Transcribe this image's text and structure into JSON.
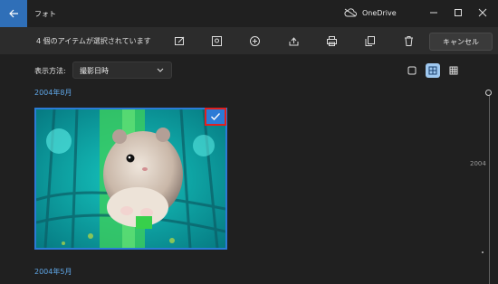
{
  "window": {
    "title": "フォト",
    "onedrive_label": "OneDrive"
  },
  "toolbar": {
    "selection_count": "4 個のアイテムが選択されています",
    "cancel_label": "キャンセル",
    "icons": [
      "edit-icon",
      "share-to-image-icon",
      "add-icon",
      "share-icon",
      "print-icon",
      "copy-icon",
      "delete-icon"
    ]
  },
  "filter": {
    "label": "表示方法:",
    "value": "撮影日時"
  },
  "view_modes": [
    "small-grid",
    "medium-grid",
    "large-grid"
  ],
  "groups": [
    {
      "date": "2004年8月",
      "photo_selected": true
    },
    {
      "date": "2004年5月"
    }
  ],
  "timeline": {
    "year": "2004"
  },
  "colors": {
    "accent": "#2b7bd6",
    "highlight": "#e02020",
    "background": "#202020"
  }
}
